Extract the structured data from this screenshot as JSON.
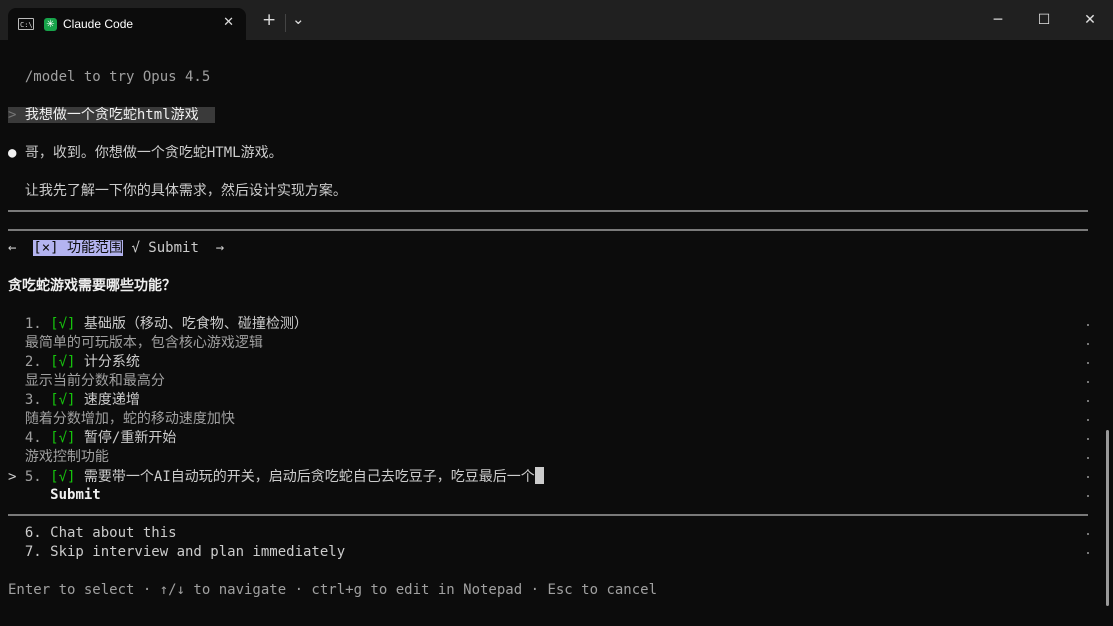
{
  "window": {
    "tab_title": "Claude Code",
    "tab_icon": "terminal-icon",
    "app_icon": "claude-asterisk-icon",
    "new_tab": "+",
    "dropdown": "⌄",
    "minimize": "─",
    "maximize": "☐",
    "close": "✕"
  },
  "terminal": {
    "hint": "/model to try Opus 4.5",
    "user_prompt_marker": ">",
    "user_prompt": "我想做一个贪吃蛇html游戏",
    "bullet": "●",
    "reply_1": "哥，收到。你想做一个贪吃蛇HTML游戏。",
    "reply_2": "让我先了解一下你的具体需求，然后设计实现方案。",
    "nav_left": "←",
    "active_tab": "[×] 功能范围",
    "submit_tab": "√ Submit",
    "nav_right": "→",
    "question": "贪吃蛇游戏需要哪些功能？",
    "options": [
      {
        "num": "1.",
        "check": "[√]",
        "title": "基础版（移动、吃食物、碰撞检测）",
        "desc": "最简单的可玩版本，包含核心游戏逻辑"
      },
      {
        "num": "2.",
        "check": "[√]",
        "title": "计分系统",
        "desc": "显示当前分数和最高分"
      },
      {
        "num": "3.",
        "check": "[√]",
        "title": "速度递增",
        "desc": "随着分数增加，蛇的移动速度加快"
      },
      {
        "num": "4.",
        "check": "[√]",
        "title": "暂停/重新开始",
        "desc": "游戏控制功能"
      }
    ],
    "custom_option": {
      "pointer": ">",
      "num": "5.",
      "check": "[√]",
      "text": "需要带一个AI自动玩的开关，启动后贪吃蛇自己去吃豆子，吃豆最后一个"
    },
    "submit_label": "Submit",
    "extra_options": [
      "6. Chat about this",
      "7. Skip interview and plan immediately"
    ],
    "footer": "Enter to select · ↑/↓ to navigate · ctrl+g to edit in Notepad · Esc to cancel"
  },
  "colors": {
    "background": "#0c0c0c",
    "titlebar": "#202020",
    "check_green": "#16c60c",
    "active_tab_bg": "#b4b4f0"
  }
}
